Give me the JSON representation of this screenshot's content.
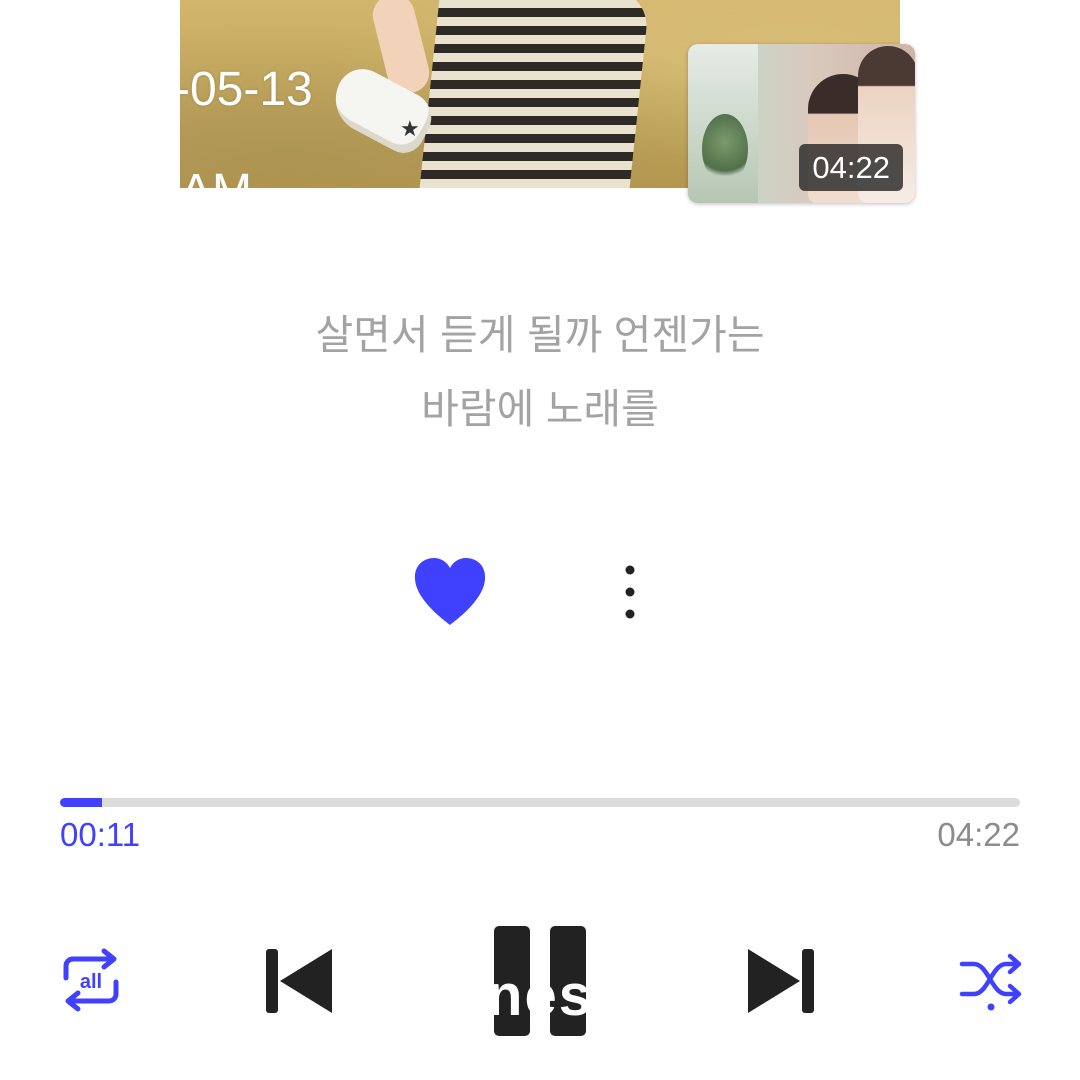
{
  "album": {
    "date_overlay": "-05-13",
    "time_overlay": "AM"
  },
  "music_video": {
    "duration": "04:22"
  },
  "lyrics": {
    "line1": "살면서 듣게 될까 언젠가는",
    "line2": "바람에 노래를"
  },
  "actions": {
    "liked": true,
    "heart_icon": "heart-filled-icon",
    "more_icon": "more-vertical-icon"
  },
  "playback": {
    "elapsed": "00:11",
    "total": "04:22",
    "progress_fraction": 0.044
  },
  "controls": {
    "repeat_label": "all",
    "repeat_icon": "repeat-all-icon",
    "prev_icon": "skip-previous-icon",
    "pause_icon": "pause-icon",
    "next_icon": "skip-next-icon",
    "shuffle_icon": "shuffle-icon",
    "overlay_text": "nes"
  },
  "colors": {
    "accent": "#4040ff",
    "control_dark": "#222222",
    "lyrics_gray": "#a3a3a3",
    "track_gray": "#dcdcdc"
  }
}
